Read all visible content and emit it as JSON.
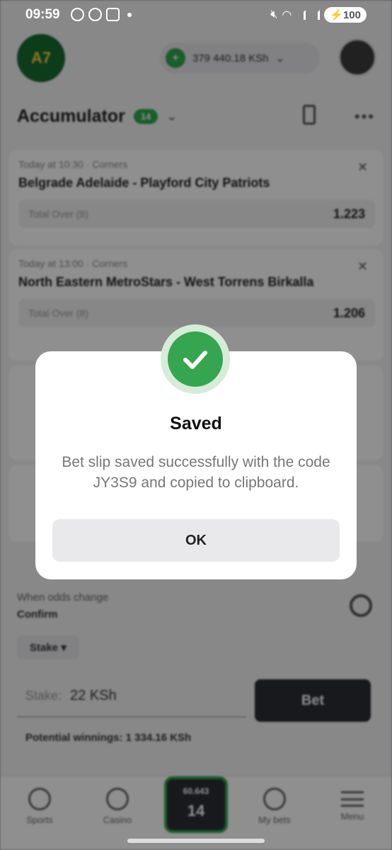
{
  "status_bar": {
    "time": "09:59",
    "battery": "100"
  },
  "header": {
    "balance": "379 440.18 KSh"
  },
  "accumulator": {
    "title": "Accumulator",
    "count": "14"
  },
  "cards": [
    {
      "meta": "Today at 10:30 · Corners",
      "match": "Belgrade Adelaide - Playford City Patriots",
      "pick": "Total Over (8)",
      "odd": "1.223"
    },
    {
      "meta": "Today at 13:00 · Corners",
      "match": "North Eastern MetroStars - West Torrens Birkalla",
      "pick": "Total Over (8)",
      "odd": "1.206"
    }
  ],
  "bet_panel": {
    "odds_change_label": "When odds change",
    "odds_change_value": "Confirm",
    "stake_chip": "Stake",
    "stake_label": "Stake:",
    "stake_value": "22 KSh",
    "bet_button": "Bet",
    "potential_winnings": "Potential winnings: 1 334.16 KSh"
  },
  "tabbar": {
    "sports": "Sports",
    "casino": "Casino",
    "slip_odds": "60.643",
    "slip_count": "14",
    "my_bets": "My bets",
    "menu": "Menu"
  },
  "dialog": {
    "title": "Saved",
    "message": "Bet slip saved successfully with the code JY3S9 and copied to clipboard.",
    "ok_button": "OK"
  },
  "colors": {
    "accent": "#36a54f",
    "brand_green": "#2da84a",
    "dark_button": "#2b2d33"
  }
}
